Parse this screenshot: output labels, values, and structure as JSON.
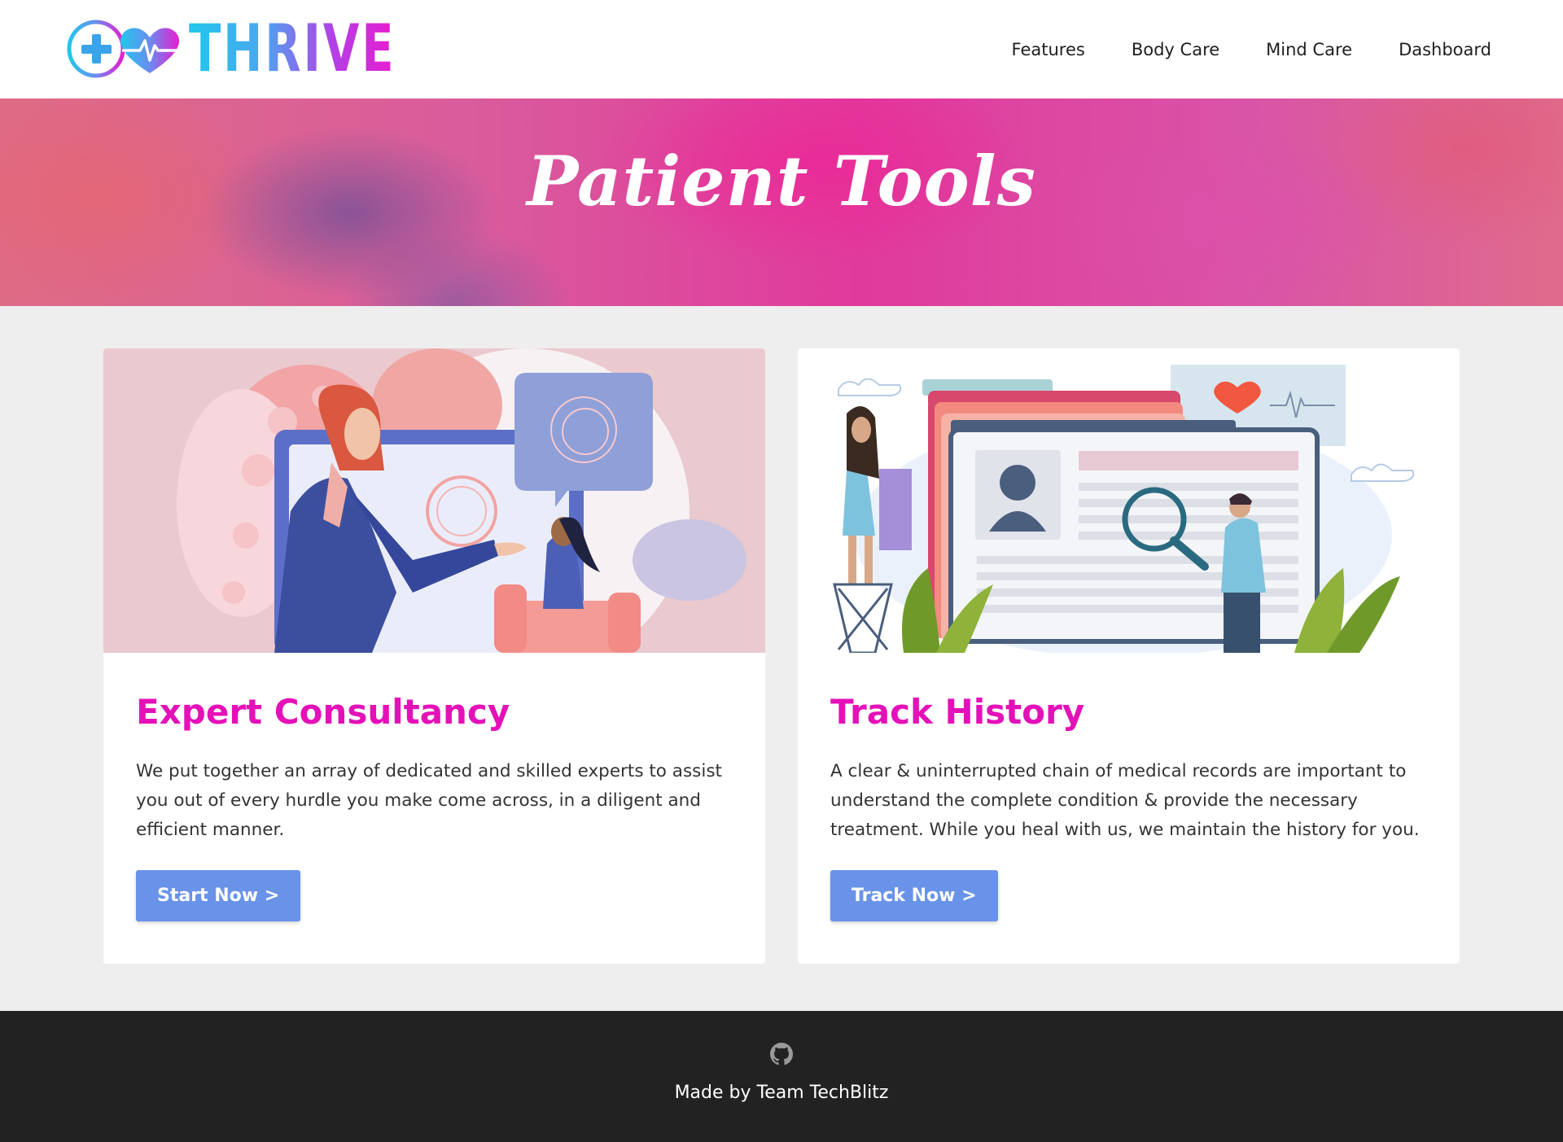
{
  "brand": {
    "name": "THRIVE",
    "logo_icon": "medical-plus-heart-icon"
  },
  "nav": {
    "items": [
      {
        "label": "Features"
      },
      {
        "label": "Body Care"
      },
      {
        "label": "Mind Care"
      },
      {
        "label": "Dashboard"
      }
    ]
  },
  "hero": {
    "title": "Patient Tools"
  },
  "cards": [
    {
      "title": "Expert Consultancy",
      "text": "We put together an array of dedicated and skilled experts to assist you out of every hurdle you make come across, in a diligent and efficient manner.",
      "button": "Start Now >",
      "illustration": "consultation-illustration"
    },
    {
      "title": "Track History",
      "text": "A clear & uninterrupted chain of medical records are important to understand the complete condition & provide the necessary treatment. While you heal with us, we maintain the history for you.",
      "button": "Track Now >",
      "illustration": "medical-records-illustration"
    }
  ],
  "footer": {
    "icon": "github-icon",
    "text": "Made by Team TechBlitz"
  },
  "colors": {
    "accent": "#e411b8",
    "button": "#6993e8",
    "footer_bg": "#222222",
    "page_bg": "#eeeeee"
  }
}
